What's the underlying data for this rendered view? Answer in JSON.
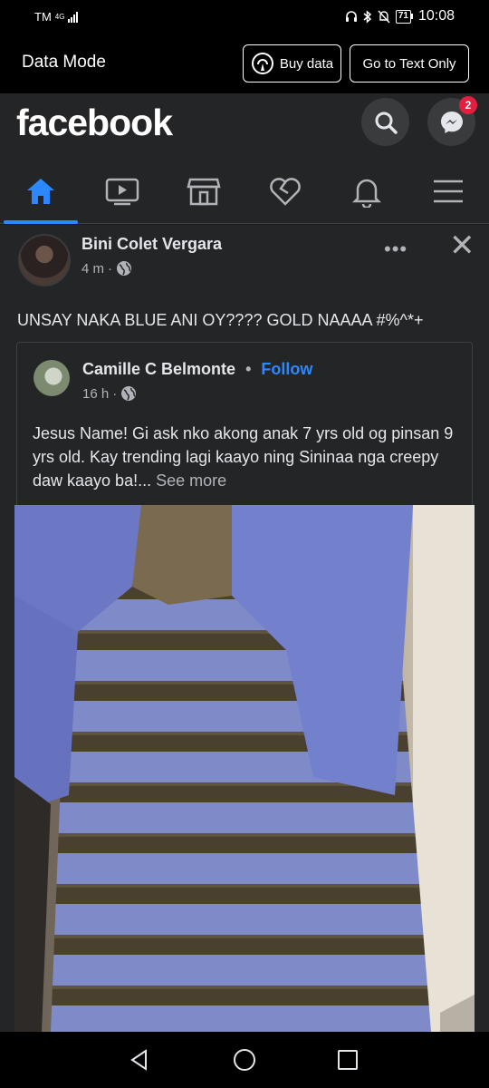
{
  "status_bar": {
    "carrier": "TM",
    "network": "4G",
    "time": "10:08",
    "battery": "71"
  },
  "data_mode": {
    "title": "Data Mode",
    "buy_label": "Buy data",
    "text_only_label": "Go to Text Only"
  },
  "header": {
    "logo": "facebook",
    "messenger_badge": "2"
  },
  "nav": {
    "items": [
      "home-icon",
      "video-icon",
      "marketplace-icon",
      "dating-icon",
      "notifications-icon",
      "menu-icon"
    ],
    "active": "home-icon",
    "accent": "#2d88ff"
  },
  "post": {
    "author": "Bini Colet Vergara",
    "time": "4 m",
    "more": "•••",
    "close": "✕",
    "text": "UNSAY NAKA BLUE ANI OY???? GOLD NAAAA #%^*+",
    "shared": {
      "author": "Camille C Belmonte",
      "separator": "•",
      "follow": "Follow",
      "time": "16 h",
      "text": "Jesus Name! Gi ask nko akong anak 7 yrs old og pinsan 9 yrs old. Kay trending lagi kaayo ning Sininaa nga creepy daw kaayo ba!...",
      "see_more": "See more"
    }
  }
}
